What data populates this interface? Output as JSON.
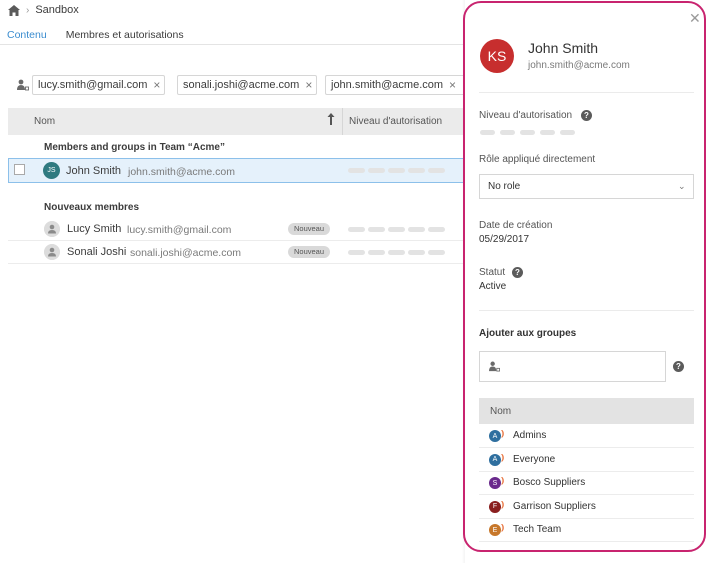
{
  "breadcrumb": {
    "current": "Sandbox"
  },
  "tabs": [
    {
      "label": "Contenu"
    },
    {
      "label": "Membres et autorisations"
    }
  ],
  "chips": [
    {
      "email": "lucy.smith@gmail.com",
      "remove": "×"
    },
    {
      "email": "sonali.joshi@acme.com",
      "remove": "×"
    },
    {
      "email": "john.smith@acme.com",
      "remove": "×"
    }
  ],
  "table": {
    "col_name": "Nom",
    "col_level": "Niveau d'autorisation",
    "section_team": "Members and groups in Team “Acme”",
    "team_member": {
      "initials": "JS",
      "name": "John Smith",
      "email": "john.smith@acme.com"
    },
    "section_new": "Nouveaux membres",
    "new_members": [
      {
        "name": "Lucy Smith",
        "email": "lucy.smith@gmail.com",
        "badge": "Nouveau"
      },
      {
        "name": "Sonali Joshi",
        "email": "sonali.joshi@acme.com",
        "badge": "Nouveau"
      }
    ]
  },
  "panel": {
    "initials": "KS",
    "name": "John Smith",
    "email": "john.smith@acme.com",
    "permission_label": "Niveau d'autorisation",
    "role_label": "Rôle appliqué directement",
    "role_value": "No role",
    "created_label": "Date de création",
    "created_value": "05/29/2017",
    "status_label": "Statut",
    "status_value": "Active",
    "groups_label": "Ajouter aux groupes",
    "groups_header": "Nom",
    "groups": [
      {
        "letter": "A",
        "name": "Admins",
        "color": "#2f6f9f",
        "wave": "#e8703a"
      },
      {
        "letter": "A",
        "name": "Everyone",
        "color": "#2f6f9f",
        "wave": "#e8703a"
      },
      {
        "letter": "S",
        "name": "Bosco Suppliers",
        "color": "#6a2a8c",
        "wave": "#e8703a"
      },
      {
        "letter": "F",
        "name": "Garrison Suppliers",
        "color": "#8a1f1f",
        "wave": "#e8703a"
      },
      {
        "letter": "E",
        "name": "Tech Team",
        "color": "#c7772a",
        "wave": "#e8703a"
      }
    ]
  },
  "colors": {
    "accent": "#3a8ccf",
    "highlight": "#c8246f",
    "selected_row": "#e5f1fb"
  }
}
